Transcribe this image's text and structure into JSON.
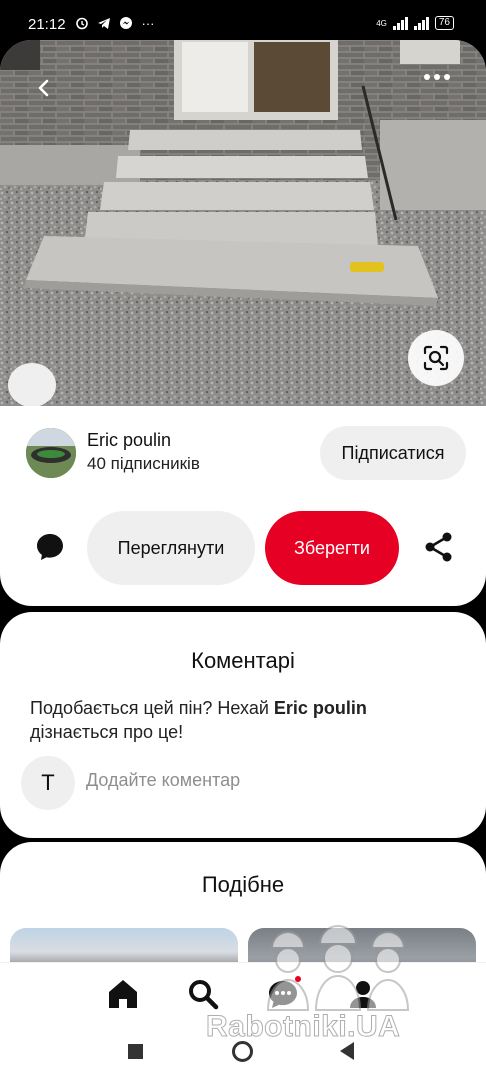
{
  "status_bar": {
    "time": "21:12",
    "network": "4G",
    "battery": "76"
  },
  "pin": {
    "author_name": "Eric poulin",
    "author_followers": "40 підписників",
    "follow_label": "Підписатися",
    "view_label": "Переглянути",
    "save_label": "Зберегти"
  },
  "comments": {
    "title": "Коментарі",
    "prompt_before": "Подобається цей пін? Нехай ",
    "prompt_author": "Eric poulin",
    "prompt_after": " дізнається про це!",
    "avatar_letter": "T",
    "input_placeholder": "Додайте коментар"
  },
  "similar": {
    "title": "Подібне"
  },
  "watermark": "Rabotniki.UA",
  "colors": {
    "save": "#e60023",
    "button_bg": "#efefef"
  },
  "icons": [
    "back-icon",
    "more-icon",
    "visual-search-icon",
    "comment-icon",
    "share-icon",
    "home-icon",
    "search-icon",
    "messages-icon",
    "profile-icon"
  ]
}
